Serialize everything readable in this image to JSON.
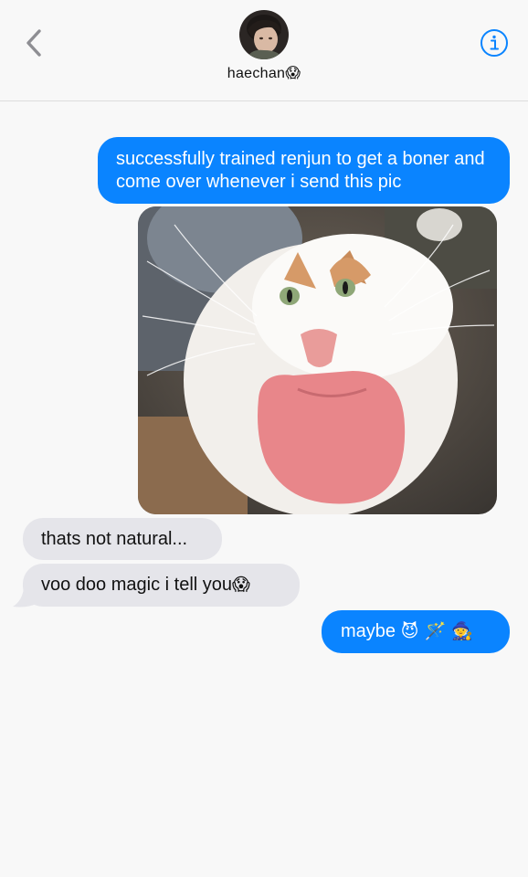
{
  "header": {
    "contact_name": "haechan",
    "contact_emoji": "😱"
  },
  "messages": [
    {
      "from": "me",
      "text": "successfully trained renjun to get a boner and come over whenever i send this pic"
    },
    {
      "from": "me",
      "type": "image",
      "alt": ""
    },
    {
      "from": "them",
      "text": "thats not natural..."
    },
    {
      "from": "them",
      "text": "voo doo magic i tell you",
      "emoji": "😱"
    },
    {
      "from": "me",
      "text": "maybe",
      "emoji": "😈 🪄 🧙"
    }
  ],
  "colors": {
    "sent_bubble": "#0a84ff",
    "received_bubble": "#e5e5ea",
    "background": "#f8f8f8",
    "accent": "#0a84ff"
  },
  "icons": {
    "back": "chevron-left-icon",
    "info": "info-circle-icon"
  }
}
